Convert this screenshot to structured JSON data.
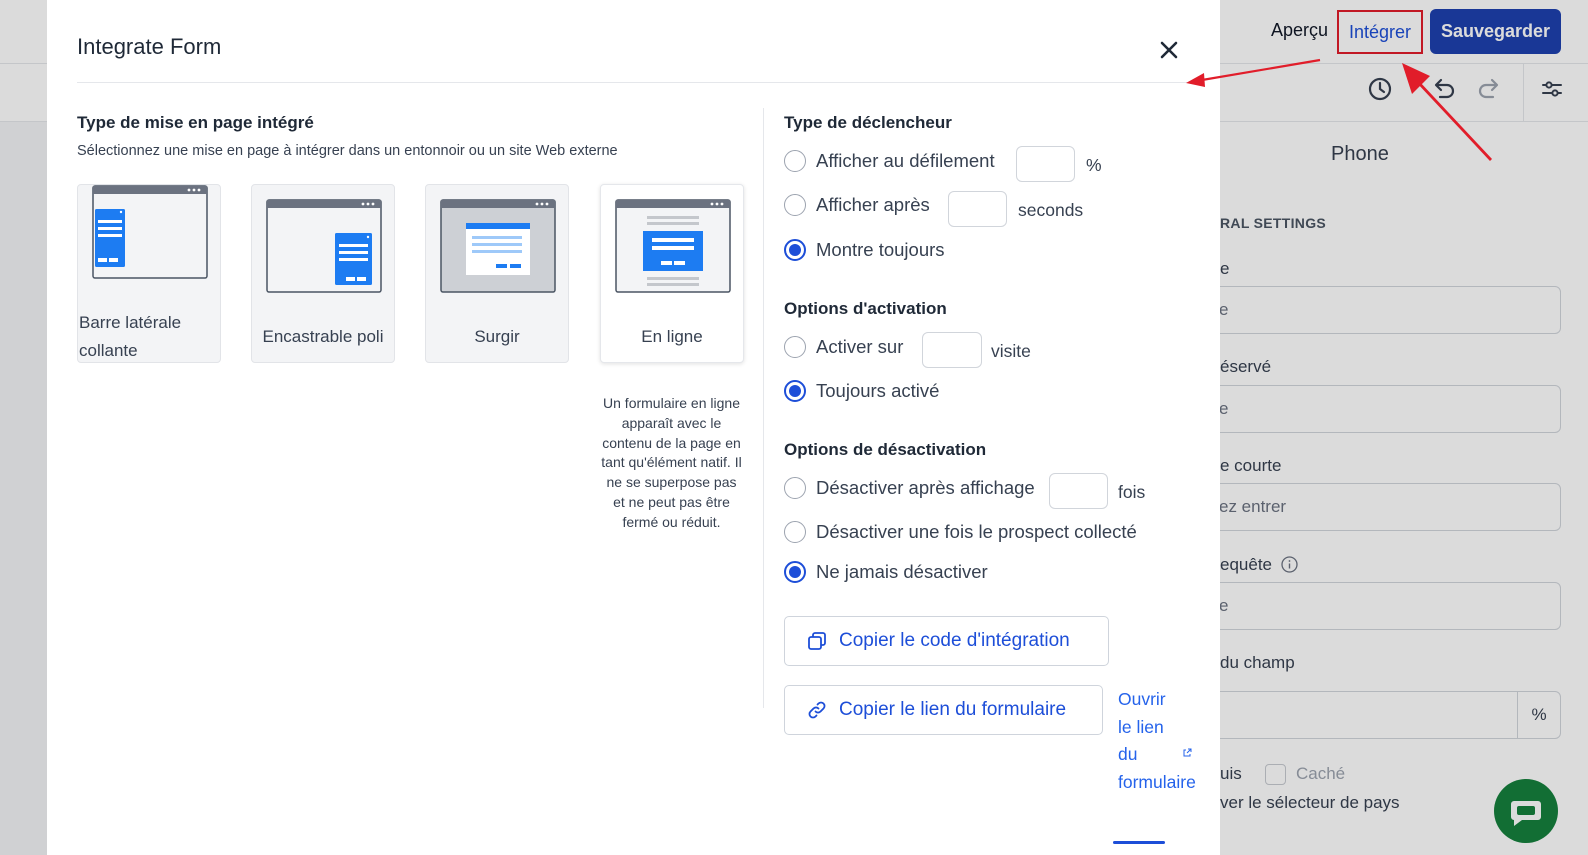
{
  "app": {
    "apercu_label": "Aperçu",
    "integrer_label": "Intégrer",
    "save_label": "Sauvegarder",
    "tab_label": "Phone",
    "section_label": "RAL SETTINGS",
    "fields": [
      {
        "label": "e",
        "value": "e"
      },
      {
        "label": "éservé",
        "value": "e"
      },
      {
        "label": "e courte",
        "value": "ez entrer"
      },
      {
        "label": "equête",
        "value": "e"
      }
    ],
    "field_width_label": "du champ",
    "percent_suffix": "%",
    "uis_label": "uis",
    "cache_label": "Caché",
    "country_selector_label": "ver le sélecteur de pays",
    "accent_color": "#1e40af",
    "annotation_color": "#e11d2a",
    "chat_color": "#15803d"
  },
  "modal": {
    "title": "Integrate Form",
    "layout_section": {
      "title": "Type de mise en page intégré",
      "subtitle": "Sélectionnez une mise en page à intégrer dans un entonnoir ou un site Web externe",
      "cards": [
        {
          "label": "Barre latérale collante",
          "selected": false
        },
        {
          "label": "Encastrable poli",
          "selected": false
        },
        {
          "label": "Surgir",
          "selected": false
        },
        {
          "label": "En ligne",
          "selected": true
        }
      ],
      "description": "Un formulaire en ligne apparaît avec le contenu de la page en tant qu'élément natif. Il ne se superpose pas et ne peut pas être fermé ou réduit."
    },
    "trigger": {
      "title": "Type de déclencheur",
      "options": [
        {
          "label": "Afficher au défilement",
          "unit": "%",
          "checked": false
        },
        {
          "label": "Afficher après",
          "unit": "seconds",
          "checked": false
        },
        {
          "label": "Montre toujours",
          "checked": true
        }
      ]
    },
    "activation": {
      "title": "Options d'activation",
      "options": [
        {
          "label": "Activer sur",
          "unit": "visite",
          "checked": false
        },
        {
          "label": "Toujours activé",
          "checked": true
        }
      ]
    },
    "deactivation": {
      "title": "Options de désactivation",
      "options": [
        {
          "label": "Désactiver après affichage",
          "unit": "fois",
          "checked": false
        },
        {
          "label": "Désactiver une fois le prospect collecté",
          "checked": false
        },
        {
          "label": "Ne jamais désactiver",
          "checked": true
        }
      ]
    },
    "copy_code_label": "Copier le code d'intégration",
    "copy_link_label": "Copier le lien du formulaire",
    "open_link_label": "Ouvrir le lien du formulaire"
  }
}
